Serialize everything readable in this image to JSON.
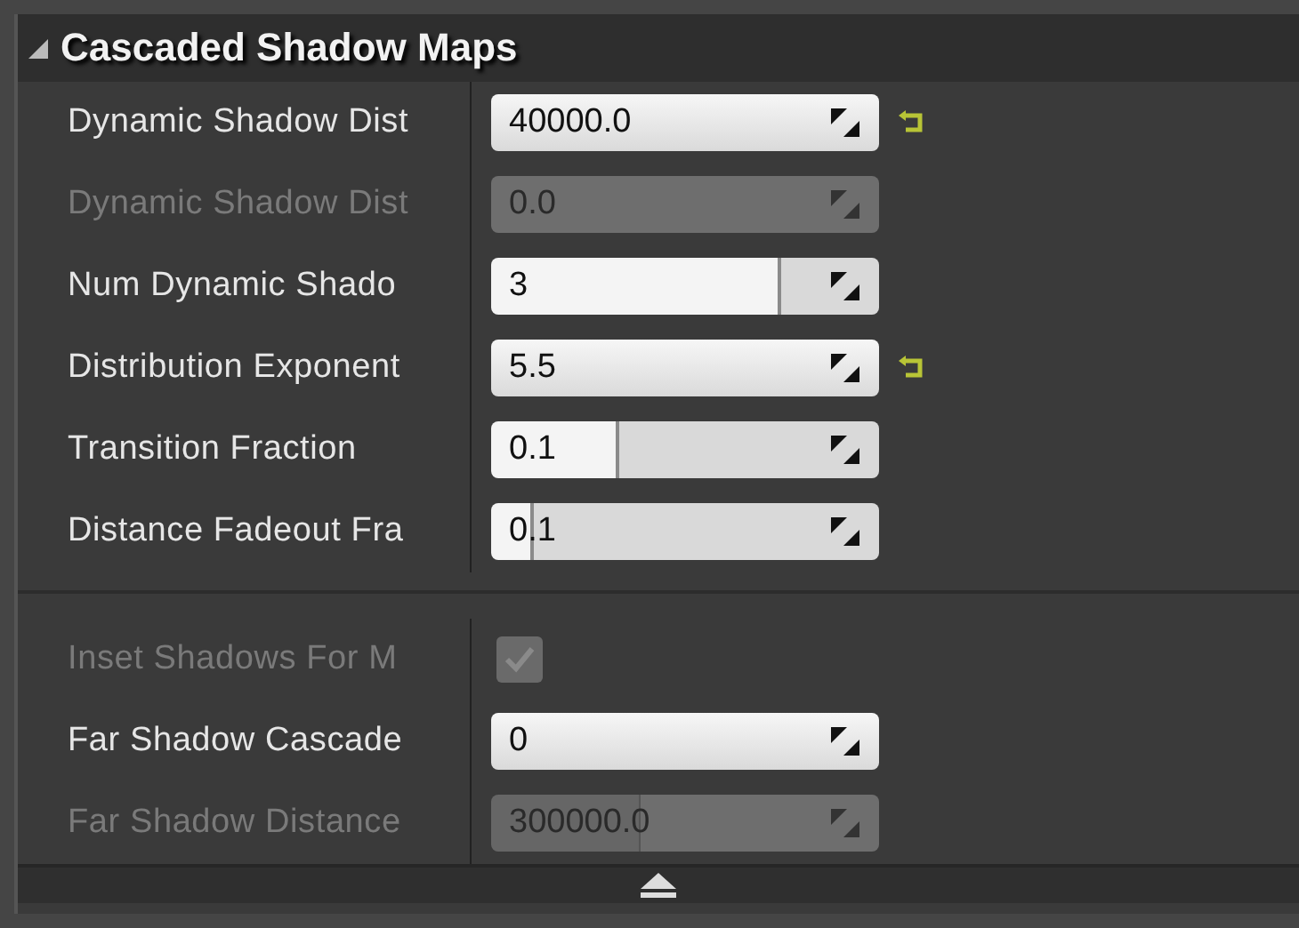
{
  "section": {
    "title": "Cascaded Shadow Maps",
    "expanded": true,
    "groups": [
      {
        "rows": [
          {
            "kind": "number",
            "label": "Dynamic Shadow Dist",
            "value": "40000.0",
            "disabled": false,
            "reset": true
          },
          {
            "kind": "number",
            "label": "Dynamic Shadow Dist",
            "value": "0.0",
            "disabled": true,
            "reset": false
          },
          {
            "kind": "slider",
            "label": "Num Dynamic Shado",
            "value": "3",
            "disabled": false,
            "reset": false,
            "level": 0.74
          },
          {
            "kind": "number",
            "label": "Distribution Exponent",
            "value": "5.5",
            "disabled": false,
            "reset": true
          },
          {
            "kind": "slider",
            "label": "Transition Fraction",
            "value": "0.1",
            "disabled": false,
            "reset": false,
            "level": 0.32
          },
          {
            "kind": "slider",
            "label": "Distance Fadeout Fra",
            "value": "0.1",
            "disabled": false,
            "reset": false,
            "level": 0.1
          }
        ]
      },
      {
        "rows": [
          {
            "kind": "checkbox",
            "label": "Inset Shadows For M",
            "checked": true,
            "disabled": true
          },
          {
            "kind": "number",
            "label": "Far Shadow Cascade",
            "value": "0",
            "disabled": false,
            "reset": false
          },
          {
            "kind": "slider",
            "label": "Far Shadow Distance",
            "value": "300000.0",
            "disabled": true,
            "reset": false,
            "level": 0.38
          }
        ]
      }
    ]
  }
}
